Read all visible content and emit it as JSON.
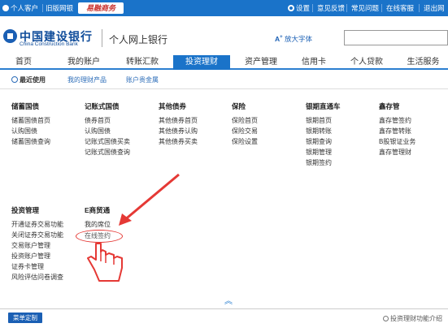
{
  "topbar": {
    "personal": "个人客户",
    "old_site": "旧版网银",
    "business": "易融商务",
    "settings": "设置",
    "feedback": "意见反馈",
    "faq": "常见问题",
    "service": "在线客服",
    "logout": "退出网"
  },
  "header": {
    "logo_cn": "中国建设银行",
    "logo_en": "China Construction Bank",
    "site_title": "个人网上银行",
    "font_size_button": "放大字体"
  },
  "nav": {
    "tabs": [
      "首页",
      "我的账户",
      "转账汇款",
      "投资理财",
      "资产管理",
      "信用卡",
      "个人贷款",
      "生活服务"
    ],
    "active": "投资理财"
  },
  "subnav": {
    "items": [
      "最近使用",
      "我的理财产品",
      "账户贵金属"
    ]
  },
  "menu": {
    "treasury": {
      "title": "储蓄国债",
      "items": [
        "储蓄国债首页",
        "认购国债",
        "储蓄国债查询"
      ]
    },
    "bookentry": {
      "title": "记账式国债",
      "items": [
        "债券首页",
        "认购国债",
        "记账式国债买卖",
        "记账式国债查询"
      ]
    },
    "otherbonds": {
      "title": "其他债券",
      "items": [
        "其他债券首页",
        "其他债券认购",
        "其他债券买卖"
      ]
    },
    "insurance": {
      "title": "保险",
      "items": [
        "保险首页",
        "保险交易",
        "保险设置"
      ]
    },
    "bankfutures": {
      "title": "银期直通车",
      "items": [
        "银期首页",
        "银期转账",
        "银期查询",
        "银期管理",
        "银期签约"
      ]
    },
    "xincunbao": {
      "title": "鑫存管",
      "items": [
        "鑫存管签约",
        "鑫存管转账",
        "B股银证业务",
        "鑫存管理财"
      ]
    },
    "invest": {
      "title": "投资管理",
      "items": [
        "开通证券交易功能",
        "关闭证券交易功能",
        "交易账户管理",
        "投资账户管理",
        "证券卡管理",
        "风险评估问卷调查"
      ]
    },
    "ebusiness": {
      "title": "E商贸通",
      "items": [
        "我的席位",
        "在线签约"
      ]
    }
  },
  "footer": {
    "menu_custom": "菜单定制",
    "intro": "投资理财功能介绍"
  }
}
